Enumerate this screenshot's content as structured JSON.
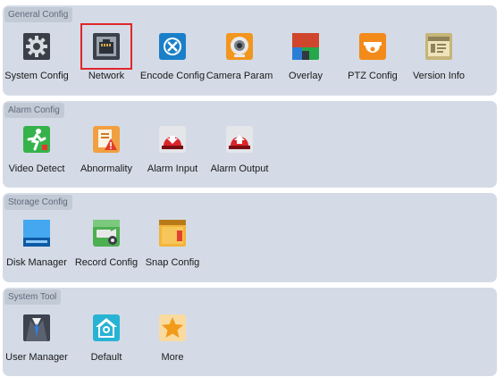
{
  "sections": [
    {
      "title": "General Config",
      "items": [
        {
          "label": "System Config",
          "icon": "gear-icon"
        },
        {
          "label": "Network",
          "icon": "network-port-icon"
        },
        {
          "label": "Encode Config",
          "icon": "encode-icon"
        },
        {
          "label": "Camera Param",
          "icon": "webcam-icon"
        },
        {
          "label": "Overlay",
          "icon": "overlay-icon"
        },
        {
          "label": "PTZ Config",
          "icon": "dome-camera-icon"
        },
        {
          "label": "Version Info",
          "icon": "version-icon"
        }
      ]
    },
    {
      "title": "Alarm Config",
      "items": [
        {
          "label": "Video Detect",
          "icon": "motion-person-icon"
        },
        {
          "label": "Abnormality",
          "icon": "document-warning-icon"
        },
        {
          "label": "Alarm Input",
          "icon": "alarm-input-icon"
        },
        {
          "label": "Alarm Output",
          "icon": "alarm-output-icon"
        }
      ]
    },
    {
      "title": "Storage Config",
      "items": [
        {
          "label": "Disk Manager",
          "icon": "hard-disk-icon"
        },
        {
          "label": "Record Config",
          "icon": "record-camera-icon"
        },
        {
          "label": "Snap Config",
          "icon": "folder-icon"
        }
      ]
    },
    {
      "title": "System Tool",
      "items": [
        {
          "label": "User Manager",
          "icon": "user-suit-icon"
        },
        {
          "label": "Default",
          "icon": "home-default-icon"
        },
        {
          "label": "More",
          "icon": "star-icon"
        }
      ]
    }
  ],
  "selected_item": "Network",
  "colors": {
    "panel_bg": "#d4dbe6",
    "section_label_bg": "#c2cad6",
    "selection_border": "#e0262b"
  }
}
